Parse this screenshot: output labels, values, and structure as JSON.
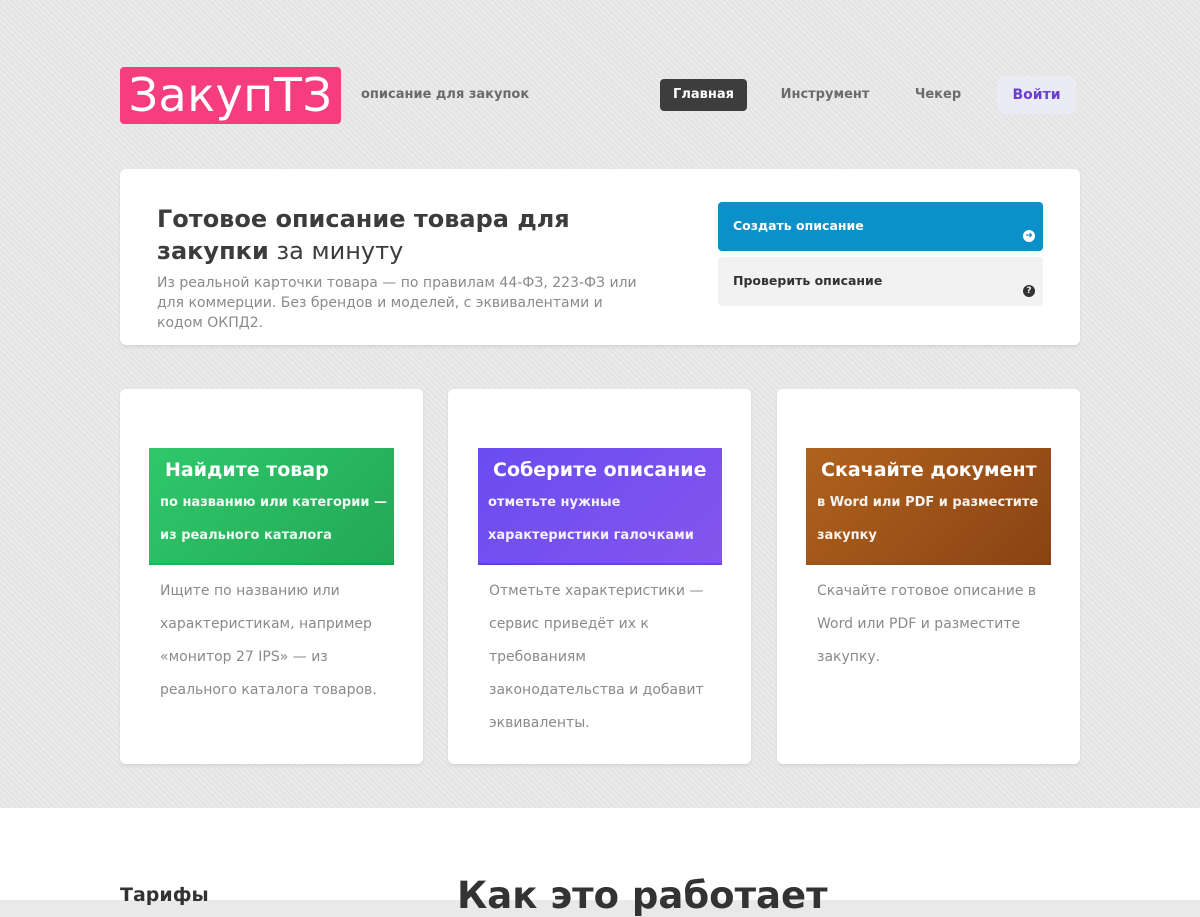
{
  "header": {
    "logo": "ЗакупТЗ",
    "tagline": "описание для закупок",
    "nav": {
      "home": "Главная",
      "tool": "Инструмент",
      "checker": "Чекер",
      "login": "Войти"
    }
  },
  "hero": {
    "title_bold": "Готовое описание товара для закупки",
    "title_rest": " за минуту",
    "description": "Из реальной карточки товара — по правилам 44-ФЗ, 223-ФЗ или для коммерции. Без брендов и моделей, с эквивалентами и кодом ОКПД2.",
    "create_label": "Создать описание",
    "check_label": "Проверить описание",
    "create_icon": "arrow-right-circle-icon",
    "check_icon": "question-circle-icon"
  },
  "cards": [
    {
      "title": "Найдите товар",
      "subtitle": "по названию или категории — из реального каталога",
      "text": "Ищите по названию или характеристикам, например «монитор 27 IPS» — из реального каталога товаров.",
      "color": "#2fc86b"
    },
    {
      "title": "Соберите описание",
      "subtitle": "отметьте нужные характеристики галочками",
      "text": "Отметьте характеристики — сервис приведёт их к требованиям законодательства и добавит эквиваленты.",
      "color": "#6a4cf0"
    },
    {
      "title": "Скачайте документ",
      "subtitle": "в Word или PDF и разместите закупку",
      "text": "Скачайте готовое описание в Word или PDF и разместите закупку.",
      "color": "#b0631e"
    }
  ],
  "footer": {
    "tariffs": "Тарифы",
    "how_it_works": "Как это работает"
  },
  "colors": {
    "brand": "#f63e7e",
    "primary": "#0b90c9",
    "login": "#6a3fcf"
  }
}
